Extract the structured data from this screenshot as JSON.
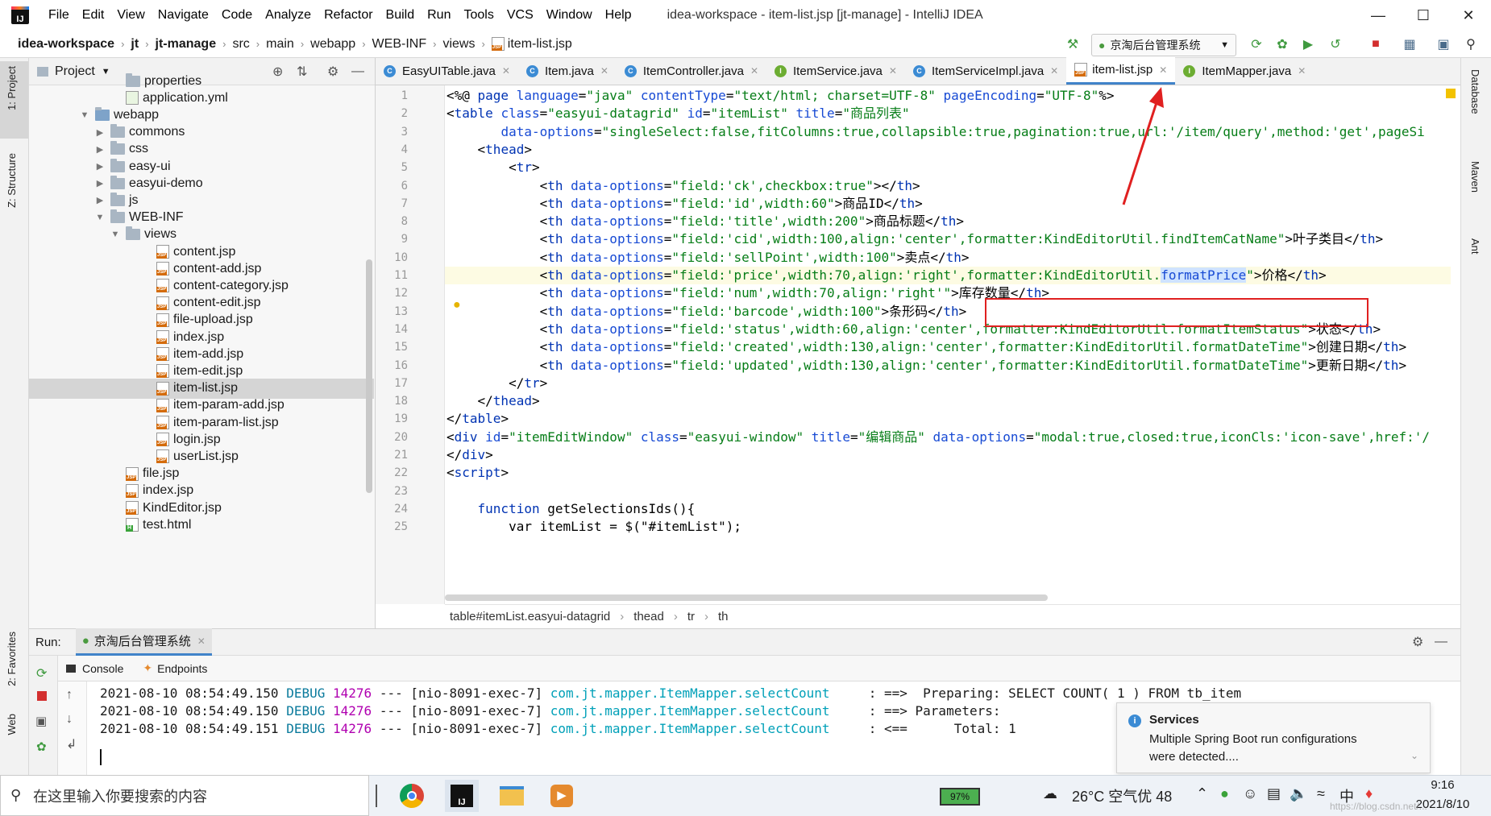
{
  "window": {
    "menus": [
      "File",
      "Edit",
      "View",
      "Navigate",
      "Code",
      "Analyze",
      "Refactor",
      "Build",
      "Run",
      "Tools",
      "VCS",
      "Window",
      "Help"
    ],
    "title": "idea-workspace - item-list.jsp [jt-manage] - IntelliJ IDEA"
  },
  "navbar": {
    "crumbs": [
      "idea-workspace",
      "jt",
      "jt-manage",
      "src",
      "main",
      "webapp",
      "WEB-INF",
      "views",
      "item-list.jsp"
    ],
    "run_config": "京淘后台管理系统"
  },
  "left_stripe": {
    "project": "1: Project",
    "structure": "Z: Structure",
    "favorites": "2: Favorites",
    "web": "Web"
  },
  "right_stripe": {
    "database": "Database",
    "maven": "Maven",
    "ant": "Ant"
  },
  "project_panel": {
    "title": "Project",
    "tree": [
      {
        "label": "properties",
        "type": "folder",
        "depth": 6,
        "arrow": ""
      },
      {
        "label": "application.yml",
        "type": "yml",
        "depth": 6,
        "arrow": ""
      },
      {
        "label": "webapp",
        "type": "webfolder",
        "depth": 4,
        "arrow": "▼"
      },
      {
        "label": "commons",
        "type": "folder",
        "depth": 5,
        "arrow": "▶"
      },
      {
        "label": "css",
        "type": "folder",
        "depth": 5,
        "arrow": "▶"
      },
      {
        "label": "easy-ui",
        "type": "folder",
        "depth": 5,
        "arrow": "▶"
      },
      {
        "label": "easyui-demo",
        "type": "folder",
        "depth": 5,
        "arrow": "▶"
      },
      {
        "label": "js",
        "type": "folder",
        "depth": 5,
        "arrow": "▶"
      },
      {
        "label": "WEB-INF",
        "type": "folder",
        "depth": 5,
        "arrow": "▼"
      },
      {
        "label": "views",
        "type": "folder",
        "depth": 6,
        "arrow": "▼"
      },
      {
        "label": "content.jsp",
        "type": "jsp",
        "depth": 8,
        "arrow": ""
      },
      {
        "label": "content-add.jsp",
        "type": "jsp",
        "depth": 8,
        "arrow": ""
      },
      {
        "label": "content-category.jsp",
        "type": "jsp",
        "depth": 8,
        "arrow": ""
      },
      {
        "label": "content-edit.jsp",
        "type": "jsp",
        "depth": 8,
        "arrow": ""
      },
      {
        "label": "file-upload.jsp",
        "type": "jsp",
        "depth": 8,
        "arrow": ""
      },
      {
        "label": "index.jsp",
        "type": "jsp",
        "depth": 8,
        "arrow": ""
      },
      {
        "label": "item-add.jsp",
        "type": "jsp",
        "depth": 8,
        "arrow": ""
      },
      {
        "label": "item-edit.jsp",
        "type": "jsp",
        "depth": 8,
        "arrow": ""
      },
      {
        "label": "item-list.jsp",
        "type": "jsp",
        "depth": 8,
        "arrow": "",
        "selected": true
      },
      {
        "label": "item-param-add.jsp",
        "type": "jsp",
        "depth": 8,
        "arrow": ""
      },
      {
        "label": "item-param-list.jsp",
        "type": "jsp",
        "depth": 8,
        "arrow": ""
      },
      {
        "label": "login.jsp",
        "type": "jsp",
        "depth": 8,
        "arrow": ""
      },
      {
        "label": "userList.jsp",
        "type": "jsp",
        "depth": 8,
        "arrow": ""
      },
      {
        "label": "file.jsp",
        "type": "jsp",
        "depth": 6,
        "arrow": ""
      },
      {
        "label": "index.jsp",
        "type": "jsp",
        "depth": 6,
        "arrow": ""
      },
      {
        "label": "KindEditor.jsp",
        "type": "jsp",
        "depth": 6,
        "arrow": ""
      },
      {
        "label": "test.html",
        "type": "html",
        "depth": 6,
        "arrow": ""
      }
    ]
  },
  "tabs": [
    {
      "label": "EasyUITable.java",
      "icon": "c"
    },
    {
      "label": "Item.java",
      "icon": "c"
    },
    {
      "label": "ItemController.java",
      "icon": "c"
    },
    {
      "label": "ItemService.java",
      "icon": "i"
    },
    {
      "label": "ItemServiceImpl.java",
      "icon": "c"
    },
    {
      "label": "item-list.jsp",
      "icon": "jsp",
      "active": true
    },
    {
      "label": "ItemMapper.java",
      "icon": "i"
    }
  ],
  "editor": {
    "line_numbers": [
      "1",
      "2",
      "3",
      "4",
      "5",
      "6",
      "7",
      "8",
      "9",
      "10",
      "11",
      "12",
      "13",
      "14",
      "15",
      "16",
      "17",
      "18",
      "19",
      "20",
      "21",
      "22",
      "23",
      "24",
      "25"
    ],
    "lines": [
      [
        [
          "pl",
          "<%@ "
        ],
        [
          "kw",
          "page "
        ],
        [
          "at",
          "language"
        ],
        [
          "pl",
          "="
        ],
        [
          "sv",
          "\"java\" "
        ],
        [
          "at",
          "contentType"
        ],
        [
          "pl",
          "="
        ],
        [
          "sv",
          "\"text/html; charset=UTF-8\" "
        ],
        [
          "at",
          "pageEncoding"
        ],
        [
          "pl",
          "="
        ],
        [
          "sv",
          "\"UTF-8\""
        ],
        [
          "pl",
          "%>"
        ]
      ],
      [
        [
          "pl",
          "<"
        ],
        [
          "tg",
          "table "
        ],
        [
          "at",
          "class"
        ],
        [
          "pl",
          "="
        ],
        [
          "sv",
          "\"easyui-datagrid\" "
        ],
        [
          "at",
          "id"
        ],
        [
          "pl",
          "="
        ],
        [
          "sv",
          "\"itemList\" "
        ],
        [
          "at",
          "title"
        ],
        [
          "pl",
          "="
        ],
        [
          "sv",
          "\"商品列表\""
        ]
      ],
      [
        [
          "pl",
          "       "
        ],
        [
          "at",
          "data-options"
        ],
        [
          "pl",
          "="
        ],
        [
          "sv",
          "\"singleSelect:false,fitColumns:true,collapsible:true,pagination:true,url:'/item/query',method:'get',pageSi"
        ]
      ],
      [
        [
          "pl",
          "    <"
        ],
        [
          "tg",
          "thead"
        ],
        [
          "pl",
          ">"
        ]
      ],
      [
        [
          "pl",
          "        <"
        ],
        [
          "tg",
          "tr"
        ],
        [
          "pl",
          ">"
        ]
      ],
      [
        [
          "pl",
          "            <"
        ],
        [
          "tg",
          "th "
        ],
        [
          "at",
          "data-options"
        ],
        [
          "pl",
          "="
        ],
        [
          "sv",
          "\"field:'ck',checkbox:true\""
        ],
        [
          "pl",
          "></"
        ],
        [
          "tg",
          "th"
        ],
        [
          "pl",
          ">"
        ]
      ],
      [
        [
          "pl",
          "            <"
        ],
        [
          "tg",
          "th "
        ],
        [
          "at",
          "data-options"
        ],
        [
          "pl",
          "="
        ],
        [
          "sv",
          "\"field:'id',width:60\""
        ],
        [
          "pl",
          ">商品ID</"
        ],
        [
          "tg",
          "th"
        ],
        [
          "pl",
          ">"
        ]
      ],
      [
        [
          "pl",
          "            <"
        ],
        [
          "tg",
          "th "
        ],
        [
          "at",
          "data-options"
        ],
        [
          "pl",
          "="
        ],
        [
          "sv",
          "\"field:'title',width:200\""
        ],
        [
          "pl",
          ">商品标题</"
        ],
        [
          "tg",
          "th"
        ],
        [
          "pl",
          ">"
        ]
      ],
      [
        [
          "pl",
          "            <"
        ],
        [
          "tg",
          "th "
        ],
        [
          "at",
          "data-options"
        ],
        [
          "pl",
          "="
        ],
        [
          "sv",
          "\"field:'cid',width:100,align:'center',formatter:KindEditorUtil.findItemCatName\""
        ],
        [
          "pl",
          ">叶子类目</"
        ],
        [
          "tg",
          "th"
        ],
        [
          "pl",
          ">"
        ]
      ],
      [
        [
          "pl",
          "            <"
        ],
        [
          "tg",
          "th "
        ],
        [
          "at",
          "data-options"
        ],
        [
          "pl",
          "="
        ],
        [
          "sv",
          "\"field:'sellPoint',width:100\""
        ],
        [
          "pl",
          ">卖点</"
        ],
        [
          "tg",
          "th"
        ],
        [
          "pl",
          ">"
        ]
      ],
      [
        [
          "pl",
          "            <"
        ],
        [
          "tg",
          "th "
        ],
        [
          "at",
          "data-options"
        ],
        [
          "pl",
          "="
        ],
        [
          "sv",
          "\"field:'price',width:70,align:'right',formatter:KindEditorUtil."
        ],
        [
          "hl",
          "formatPrice"
        ],
        [
          "sv",
          "\""
        ],
        [
          "pl",
          ">价格</"
        ],
        [
          "tg",
          "th"
        ],
        [
          "pl",
          ">"
        ]
      ],
      [
        [
          "pl",
          "            <"
        ],
        [
          "tg",
          "th "
        ],
        [
          "at",
          "data-options"
        ],
        [
          "pl",
          "="
        ],
        [
          "sv",
          "\"field:'num',width:70,align:'right'\""
        ],
        [
          "pl",
          ">库存数量</"
        ],
        [
          "tg",
          "th"
        ],
        [
          "pl",
          ">"
        ]
      ],
      [
        [
          "pl",
          "            <"
        ],
        [
          "tg",
          "th "
        ],
        [
          "at",
          "data-options"
        ],
        [
          "pl",
          "="
        ],
        [
          "sv",
          "\"field:'barcode',width:100\""
        ],
        [
          "pl",
          ">条形码</"
        ],
        [
          "tg",
          "th"
        ],
        [
          "pl",
          ">"
        ]
      ],
      [
        [
          "pl",
          "            <"
        ],
        [
          "tg",
          "th "
        ],
        [
          "at",
          "data-options"
        ],
        [
          "pl",
          "="
        ],
        [
          "sv",
          "\"field:'status',width:60,align:'center',formatter:KindEditorUtil.formatItemStatus\""
        ],
        [
          "pl",
          ">状态</"
        ],
        [
          "tg",
          "th"
        ],
        [
          "pl",
          ">"
        ]
      ],
      [
        [
          "pl",
          "            <"
        ],
        [
          "tg",
          "th "
        ],
        [
          "at",
          "data-options"
        ],
        [
          "pl",
          "="
        ],
        [
          "sv",
          "\"field:'created',width:130,align:'center',formatter:KindEditorUtil.formatDateTime\""
        ],
        [
          "pl",
          ">创建日期</"
        ],
        [
          "tg",
          "th"
        ],
        [
          "pl",
          ">"
        ]
      ],
      [
        [
          "pl",
          "            <"
        ],
        [
          "tg",
          "th "
        ],
        [
          "at",
          "data-options"
        ],
        [
          "pl",
          "="
        ],
        [
          "sv",
          "\"field:'updated',width:130,align:'center',formatter:KindEditorUtil.formatDateTime\""
        ],
        [
          "pl",
          ">更新日期</"
        ],
        [
          "tg",
          "th"
        ],
        [
          "pl",
          ">"
        ]
      ],
      [
        [
          "pl",
          "        </"
        ],
        [
          "tg",
          "tr"
        ],
        [
          "pl",
          ">"
        ]
      ],
      [
        [
          "pl",
          "    </"
        ],
        [
          "tg",
          "thead"
        ],
        [
          "pl",
          ">"
        ]
      ],
      [
        [
          "pl",
          "</"
        ],
        [
          "tg",
          "table"
        ],
        [
          "pl",
          ">"
        ]
      ],
      [
        [
          "pl",
          "<"
        ],
        [
          "tg",
          "div "
        ],
        [
          "at",
          "id"
        ],
        [
          "pl",
          "="
        ],
        [
          "sv",
          "\"itemEditWindow\" "
        ],
        [
          "at",
          "class"
        ],
        [
          "pl",
          "="
        ],
        [
          "sv",
          "\"easyui-window\" "
        ],
        [
          "at",
          "title"
        ],
        [
          "pl",
          "="
        ],
        [
          "sv",
          "\"编辑商品\" "
        ],
        [
          "at",
          "data-options"
        ],
        [
          "pl",
          "="
        ],
        [
          "sv",
          "\"modal:true,closed:true,iconCls:'icon-save',href:'/"
        ]
      ],
      [
        [
          "pl",
          "</"
        ],
        [
          "tg",
          "div"
        ],
        [
          "pl",
          ">"
        ]
      ],
      [
        [
          "pl",
          "<"
        ],
        [
          "tg",
          "script"
        ],
        [
          "pl",
          ">"
        ]
      ],
      [
        [
          "pl",
          ""
        ]
      ],
      [
        [
          "pl",
          "    "
        ],
        [
          "kw",
          "function "
        ],
        [
          "pl",
          "getSelectionsIds(){"
        ]
      ],
      [
        [
          "pl",
          "        var itemList = $(\"#itemList\");"
        ]
      ]
    ],
    "breadcrumb": [
      "table#itemList.easyui-datagrid",
      "thead",
      "tr",
      "th"
    ]
  },
  "run": {
    "label": "Run:",
    "config_tab": "京淘后台管理系统",
    "subtabs": [
      "Console",
      "Endpoints"
    ],
    "logs": [
      {
        "ts": "2021-08-10 08:54:49.150",
        "level": "DEBUG",
        "pid": "14276",
        "sep": "---",
        "thread": "[nio-8091-exec-7]",
        "logger": "com.jt.mapper.ItemMapper.selectCount",
        "msg": ": ==>  Preparing: SELECT COUNT( 1 ) FROM tb_item"
      },
      {
        "ts": "2021-08-10 08:54:49.150",
        "level": "DEBUG",
        "pid": "14276",
        "sep": "---",
        "thread": "[nio-8091-exec-7]",
        "logger": "com.jt.mapper.ItemMapper.selectCount",
        "msg": ": ==> Parameters: "
      },
      {
        "ts": "2021-08-10 08:54:49.151",
        "level": "DEBUG",
        "pid": "14276",
        "sep": "---",
        "thread": "[nio-8091-exec-7]",
        "logger": "com.jt.mapper.ItemMapper.selectCount",
        "msg": ": <==      Total: 1"
      }
    ]
  },
  "notification": {
    "title": "Services",
    "body_line1": "Multiple Spring Boot run configurations",
    "body_line2": "were detected...."
  },
  "taskbar": {
    "search_placeholder": "在这里输入你要搜索的内容",
    "battery": "97%",
    "weather": "26°C 空气优 48",
    "time": "9:16",
    "date": "2021/8/10",
    "watermark": "https://blog.csdn.net/..."
  },
  "colors": {
    "accent": "#4083c9",
    "highlight_box": "#e02020",
    "arrow": "#e02020"
  }
}
